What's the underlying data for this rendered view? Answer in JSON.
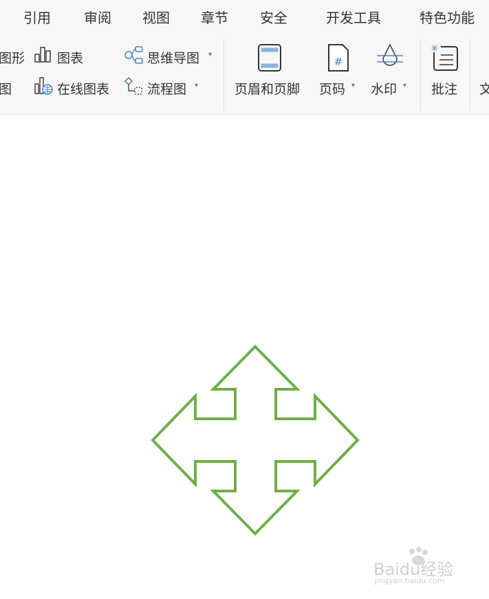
{
  "tabs": [
    "引用",
    "审阅",
    "视图",
    "章节",
    "安全",
    "开发工具",
    "特色功能"
  ],
  "ribbon": {
    "shape_partial": "图形",
    "chart": "图表",
    "mindmap": "思维导图",
    "picture_partial": "图",
    "online_chart": "在线图表",
    "flowchart": "流程图",
    "header_footer": "页眉和页脚",
    "page_number": "页码",
    "watermark": "水印",
    "comment": "批注",
    "text_partial": "文"
  },
  "icons": {
    "chart": "bar-chart-icon",
    "mindmap": "mindmap-icon",
    "online_chart": "online-chart-icon",
    "flowchart": "flowchart-icon",
    "header_footer": "header-footer-icon",
    "page_number": "page-number-icon",
    "watermark": "watermark-icon",
    "comment": "comment-icon"
  },
  "colors": {
    "shape_stroke": "#70ad47",
    "icon_blue": "#4a86c8",
    "ribbon_bg": "#f7f7f7"
  },
  "watermark_brand": {
    "logo": "Baidu经验",
    "url": "jingyan.baidu.com"
  }
}
